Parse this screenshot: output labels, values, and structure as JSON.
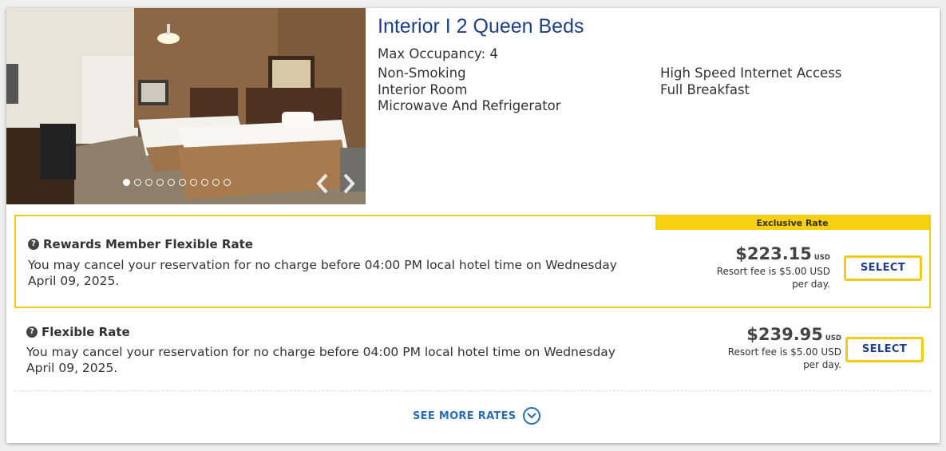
{
  "room": {
    "title": "Interior I 2 Queen Beds",
    "occupancy": "Max Occupancy: 4",
    "amenities_col1": [
      "Non-Smoking",
      "Interior Room",
      "Microwave And Refrigerator"
    ],
    "amenities_col2": [
      "High Speed Internet Access",
      "Full Breakfast"
    ]
  },
  "gallery": {
    "total_images": 10,
    "current_index": 1,
    "prev_icon": "chevron-left-icon",
    "next_icon": "chevron-right-icon"
  },
  "rates": [
    {
      "badge": "Exclusive Rate",
      "name": "Rewards Member Flexible Rate",
      "description": "You may cancel your reservation for no charge before 04:00 PM local hotel time on Wednesday April 09, 2025.",
      "price": "$223.15",
      "currency": "USD",
      "resort_fee": "Resort fee is $5.00 USD per day.",
      "button": "SELECT"
    },
    {
      "name": "Flexible Rate",
      "description": "You may cancel your reservation for no charge before 04:00 PM local hotel time on Wednesday April 09, 2025.",
      "price": "$239.95",
      "currency": "USD",
      "resort_fee": "Resort fee is $5.00 USD per day.",
      "button": "SELECT"
    }
  ],
  "see_more": {
    "label": "SEE MORE RATES",
    "icon": "chevron-down-icon"
  },
  "colors": {
    "title_blue": "#1f3f8a",
    "link_blue": "#2a6db0",
    "accent_yellow": "#f2cc14",
    "text": "#333333"
  }
}
